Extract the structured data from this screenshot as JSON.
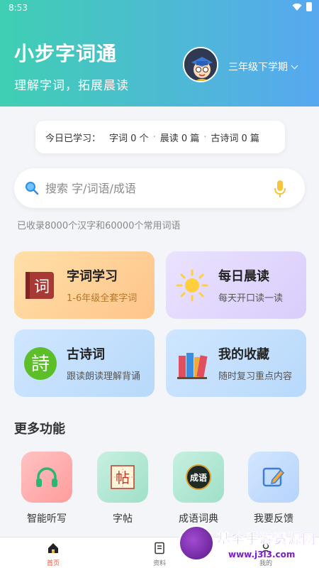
{
  "status": {
    "time": "8:53"
  },
  "header": {
    "title": "小步字词通",
    "subtitle": "理解字词，拓展晨读",
    "grade": "三年级下学期"
  },
  "stats": {
    "label": "今日已学习：",
    "chars": "字词 0 个",
    "morning": "晨读 0 篇",
    "poems": "古诗词 0 篇"
  },
  "search": {
    "placeholder": "搜索 字/词语/成语",
    "corpus_note": "已收录8000个汉字和60000个常用词语"
  },
  "cards": [
    {
      "title": "字词学习",
      "subtitle": "1-6年级全套字词",
      "icon": "book-ci-icon"
    },
    {
      "title": "每日晨读",
      "subtitle": "每天开口读一读",
      "icon": "sun-icon"
    },
    {
      "title": "古诗词",
      "subtitle": "跟读朗读理解背诵",
      "icon": "poem-shi-icon"
    },
    {
      "title": "我的收藏",
      "subtitle": "随时复习重点内容",
      "icon": "books-icon"
    }
  ],
  "more": {
    "title": "更多功能",
    "items": [
      {
        "label": "智能听写",
        "icon": "headphones-icon"
      },
      {
        "label": "字帖",
        "icon": "copybook-icon",
        "glyph": "帖"
      },
      {
        "label": "成语词典",
        "icon": "idiom-icon",
        "glyph": "成语"
      },
      {
        "label": "我要反馈",
        "icon": "feedback-icon"
      }
    ]
  },
  "tabs": [
    {
      "label": "首页",
      "icon": "home-icon",
      "active": true
    },
    {
      "label": "资料",
      "icon": "document-icon",
      "active": false
    },
    {
      "label": "我的",
      "icon": "profile-icon",
      "active": false
    }
  ],
  "cards_icons_text": {
    "ci": "词",
    "shi": "詩"
  },
  "watermark": {
    "text": "基伞手游资源网",
    "url": "www.j3l3.com"
  },
  "colors": {
    "accent": "#e0593f",
    "header_start": "#3fcfb3",
    "header_end": "#57a8f0"
  }
}
